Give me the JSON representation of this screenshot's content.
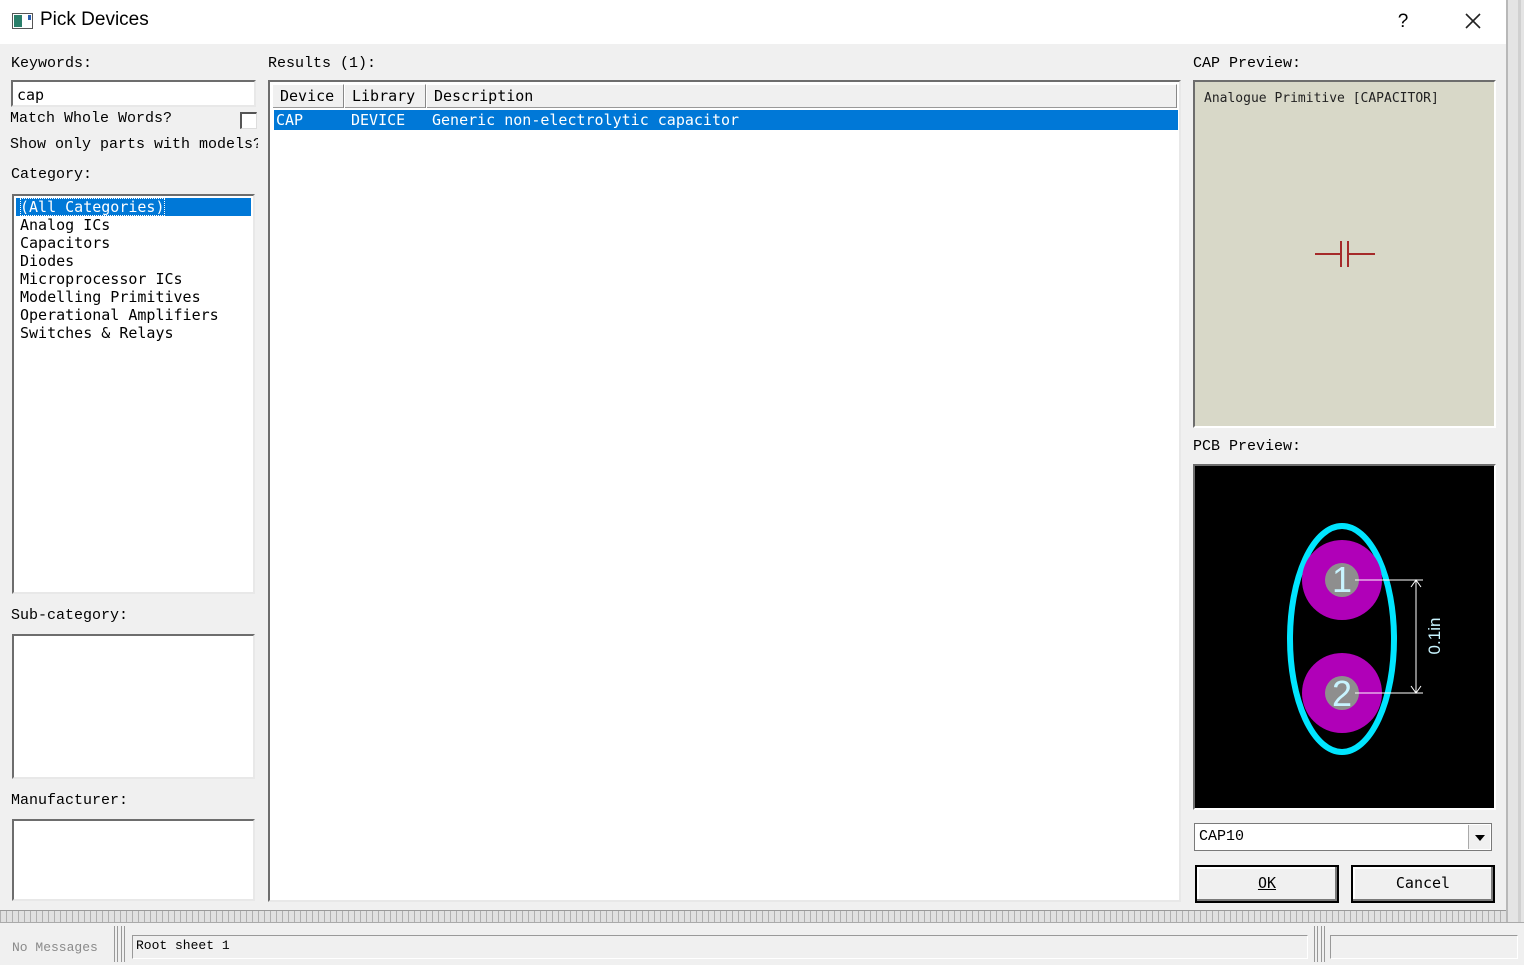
{
  "window": {
    "title": "Pick Devices",
    "help_label": "?"
  },
  "left": {
    "keywords_label": "Keywords:",
    "keywords_value": "cap",
    "match_whole_words_label": "Match Whole Words?",
    "show_only_models_label": "Show only parts with models?",
    "category_label": "Category:",
    "categories": [
      "(All Categories)",
      "Analog ICs",
      "Capacitors",
      "Diodes",
      "Microprocessor ICs",
      "Modelling Primitives",
      "Operational Amplifiers",
      "Switches & Relays"
    ],
    "selected_category": "(All Categories)",
    "subcategory_label": "Sub-category:",
    "manufacturer_label": "Manufacturer:"
  },
  "results": {
    "label": "Results (1):",
    "columns": [
      "Device",
      "Library",
      "Description"
    ],
    "rows": [
      {
        "device": "CAP",
        "library": "DEVICE",
        "description": "Generic non-electrolytic capacitor"
      }
    ]
  },
  "preview": {
    "cap_label": "CAP Preview:",
    "cap_text": "Analogue Primitive [CAPACITOR]",
    "pcb_label": "PCB Preview:",
    "pad1": "1",
    "pad2": "2",
    "dimension": "0.1in",
    "package_value": "CAP10"
  },
  "buttons": {
    "ok": "OK",
    "cancel": "Cancel"
  },
  "status": {
    "messages": "No Messages",
    "sheet": "Root sheet 1"
  },
  "colors": {
    "selection": "#0078d7",
    "cap_preview_bg": "#d8d8c8",
    "capacitor_symbol": "#a52a2a",
    "pcb_bg": "#000000",
    "pad_color": "#b000b8",
    "outline_color": "#00e5ff"
  }
}
